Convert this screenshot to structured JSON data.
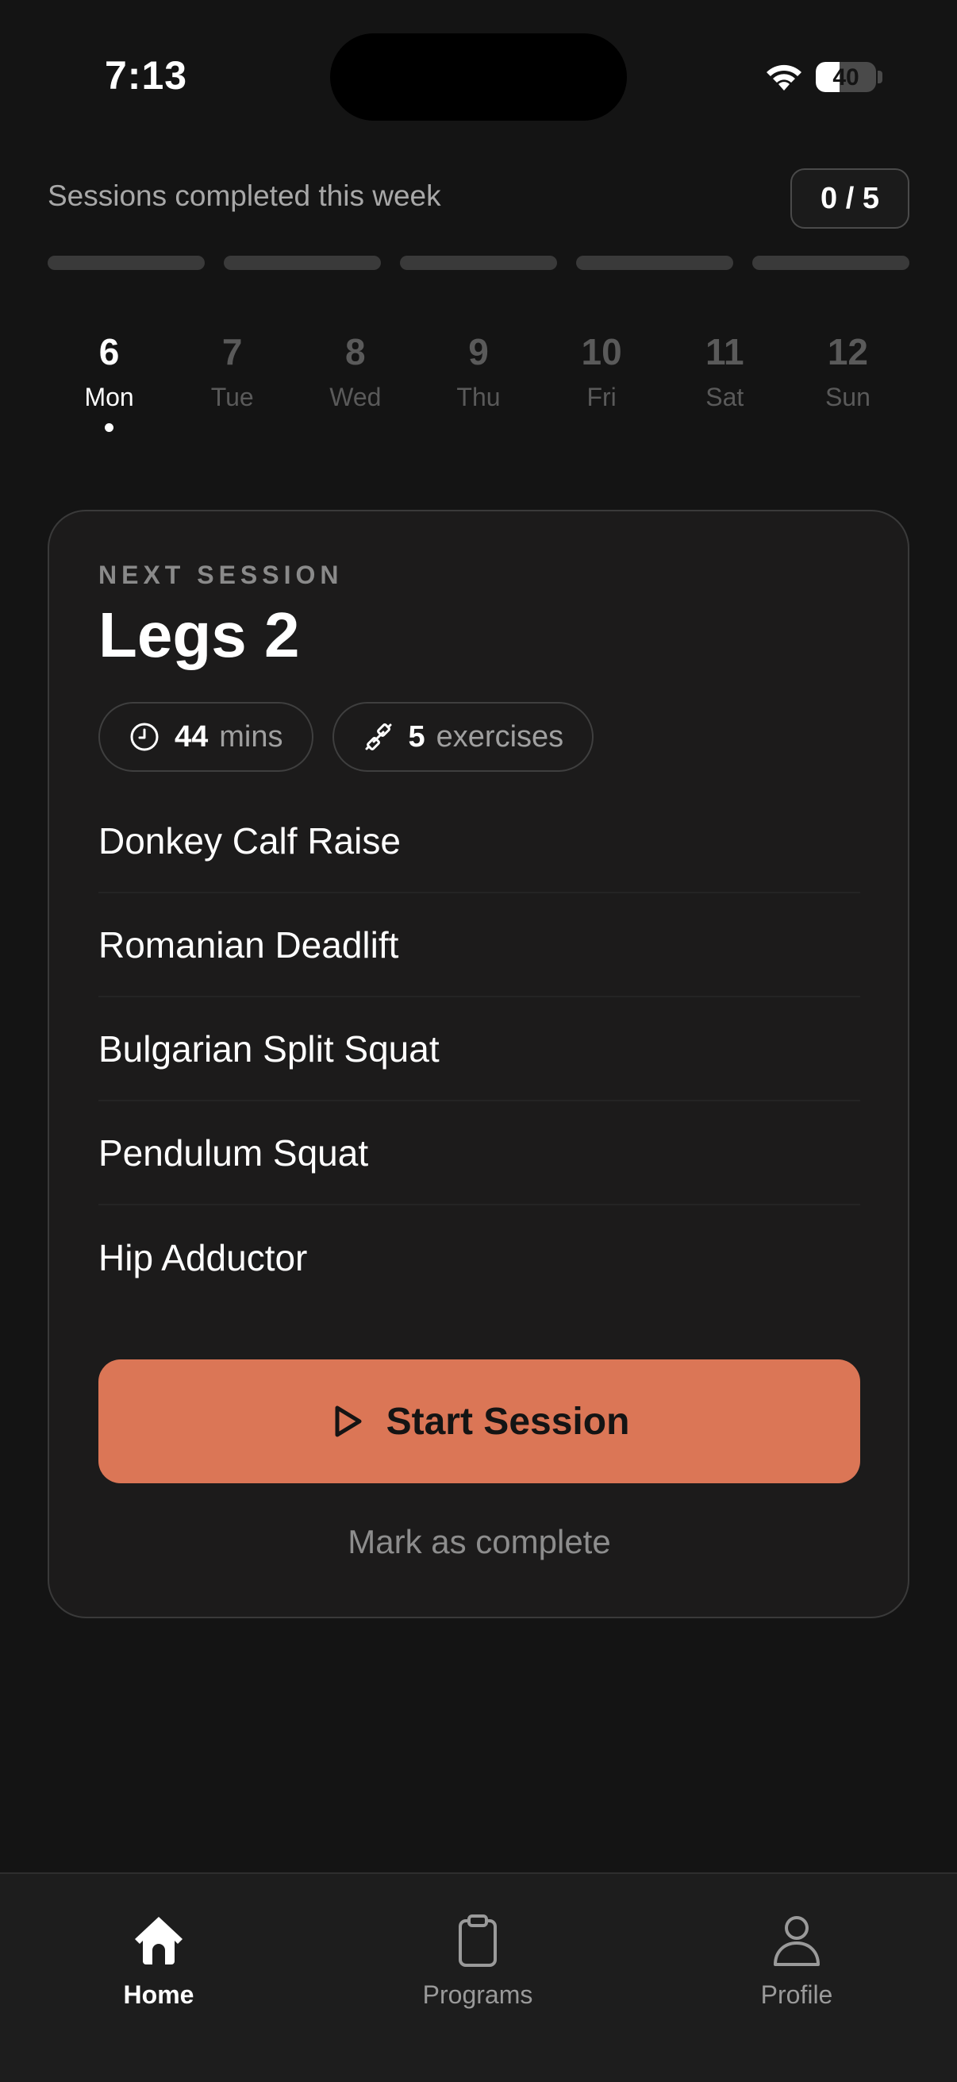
{
  "status_bar": {
    "time": "7:13",
    "battery_level": "40",
    "battery_fraction": 0.4,
    "icons": [
      "wifi-icon",
      "battery-icon"
    ]
  },
  "weekly_progress": {
    "label": "Sessions completed this week",
    "count": "0 / 5",
    "completed": 0,
    "total": 5
  },
  "days": [
    {
      "num": "6",
      "name": "Mon",
      "active": true
    },
    {
      "num": "7",
      "name": "Tue",
      "active": false
    },
    {
      "num": "8",
      "name": "Wed",
      "active": false
    },
    {
      "num": "9",
      "name": "Thu",
      "active": false
    },
    {
      "num": "10",
      "name": "Fri",
      "active": false
    },
    {
      "num": "11",
      "name": "Sat",
      "active": false
    },
    {
      "num": "12",
      "name": "Sun",
      "active": false
    }
  ],
  "session": {
    "eyebrow": "NEXT SESSION",
    "title": "Legs 2",
    "duration_value": "44",
    "duration_unit": "mins",
    "exercise_count_value": "5",
    "exercise_count_unit": "exercises",
    "exercises": [
      "Donkey Calf Raise",
      "Romanian Deadlift",
      "Bulgarian Split Squat",
      "Pendulum Squat",
      "Hip Adductor"
    ],
    "start_label": "Start Session",
    "complete_label": "Mark as complete"
  },
  "tabs": [
    {
      "label": "Home",
      "icon": "home-icon",
      "active": true
    },
    {
      "label": "Programs",
      "icon": "clipboard-icon",
      "active": false
    },
    {
      "label": "Profile",
      "icon": "person-icon",
      "active": false
    }
  ],
  "colors": {
    "background": "#141414",
    "card": "#1c1b1b",
    "accent": "#db7656",
    "muted_text": "#8d8d8d",
    "inactive_day": "#5a5a5a"
  }
}
